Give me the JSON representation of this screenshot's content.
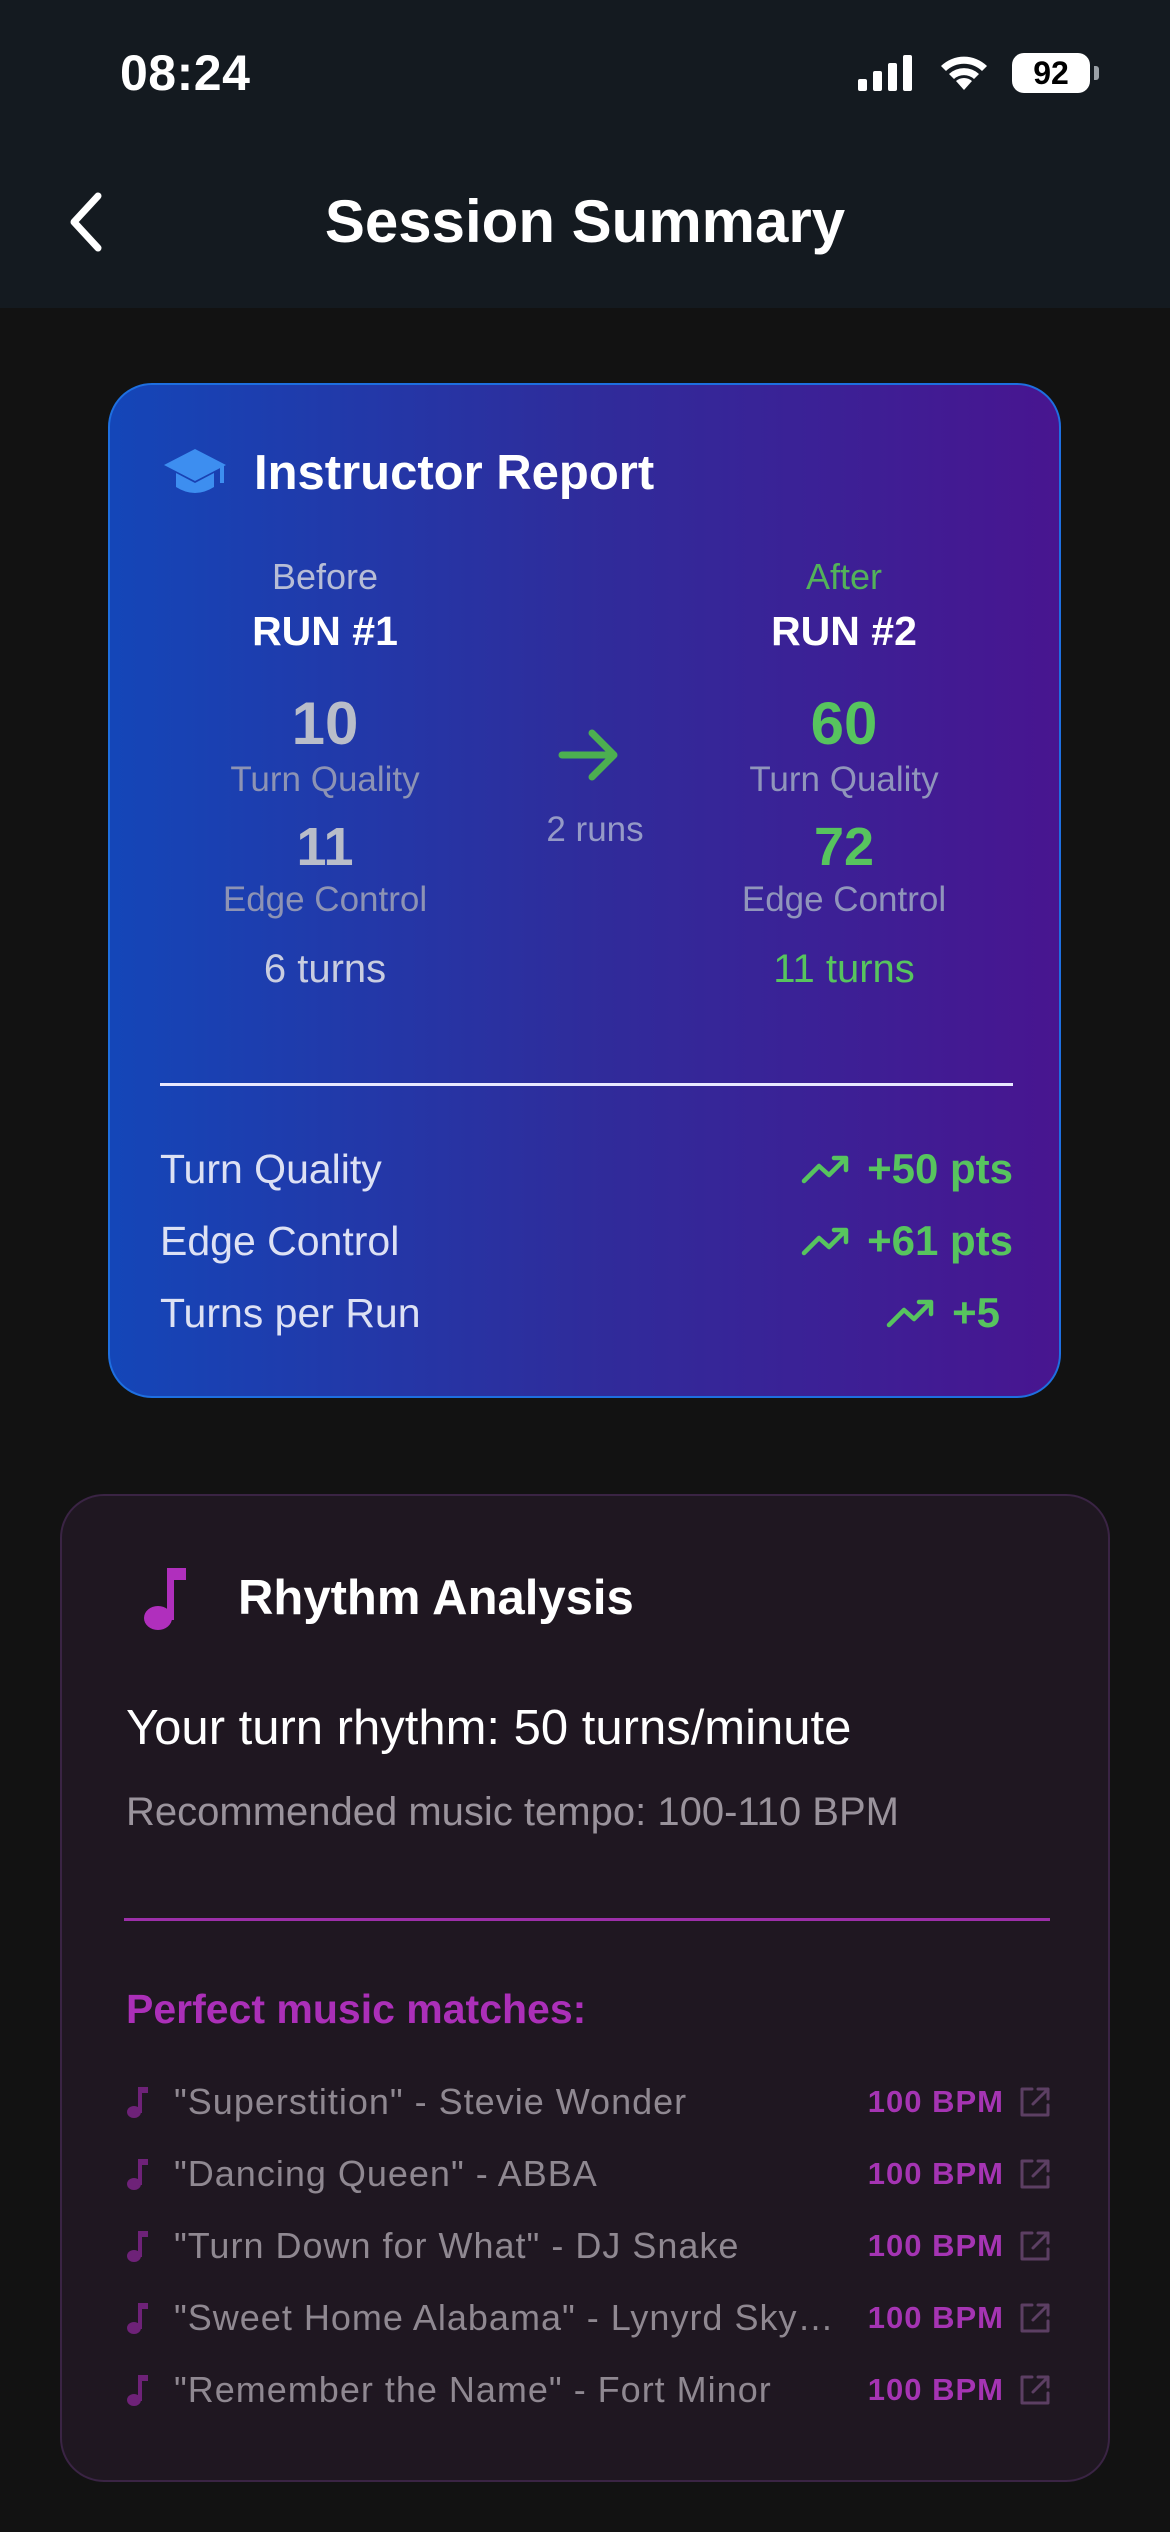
{
  "status_bar": {
    "time": "08:24",
    "battery": "92",
    "icons": [
      "signal-icon",
      "wifi-icon",
      "battery-icon"
    ]
  },
  "header": {
    "title": "Session Summary",
    "back_icon": "chevron-left-icon"
  },
  "instructor_report": {
    "icon": "graduation-cap-icon",
    "title": "Instructor Report",
    "before": {
      "label": "Before",
      "run": "RUN #1",
      "turn_quality": "10",
      "turn_quality_label": "Turn Quality",
      "edge_control": "11",
      "edge_control_label": "Edge Control",
      "turns": "6 turns"
    },
    "middle": {
      "icon": "arrow-right-icon",
      "runs": "2 runs"
    },
    "after": {
      "label": "After",
      "run": "RUN #2",
      "turn_quality": "60",
      "turn_quality_label": "Turn Quality",
      "edge_control": "72",
      "edge_control_label": "Edge Control",
      "turns": "11 turns"
    },
    "stats": [
      {
        "label": "Turn Quality",
        "value": "+50 pts",
        "icon": "trending-up-icon"
      },
      {
        "label": "Edge Control",
        "value": "+61 pts",
        "icon": "trending-up-icon"
      },
      {
        "label": "Turns per Run",
        "value": "+5",
        "icon": "trending-up-icon"
      }
    ],
    "colors": {
      "gradient_start": "#1446b8",
      "gradient_end": "#481590",
      "positive": "#57c45e"
    }
  },
  "rhythm_analysis": {
    "icon": "music-note-icon",
    "title": "Rhythm Analysis",
    "rhythm": "Your turn rhythm: 50 turns/minute",
    "tempo": "Recommended music tempo: 100-110 BPM",
    "matches_title": "Perfect music matches:",
    "songs": [
      {
        "title": "\"Superstition\" - Stevie Wonder",
        "bpm": "100 BPM"
      },
      {
        "title": "\"Dancing Queen\" - ABBA",
        "bpm": "100 BPM"
      },
      {
        "title": "\"Turn Down for What\" - DJ Snake",
        "bpm": "100 BPM"
      },
      {
        "title": "\"Sweet Home Alabama\" - Lynyrd Skynyrd",
        "bpm": "100 BPM"
      },
      {
        "title": "\"Remember the Name\" - Fort Minor",
        "bpm": "100 BPM"
      }
    ],
    "colors": {
      "accent": "#ab2fb8",
      "card_bg": "#1f1721"
    }
  }
}
